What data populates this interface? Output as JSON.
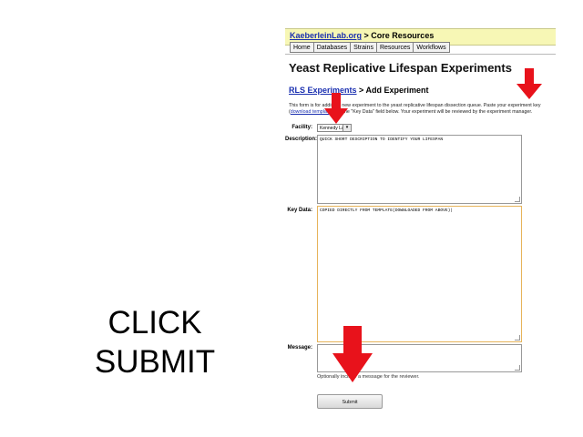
{
  "caption": {
    "line1": "CLICK",
    "line2": "SUBMIT"
  },
  "breadcrumb": {
    "site_link": "KaeberleinLab.org",
    "separator": " > ",
    "section": "Core Resources"
  },
  "nav": {
    "items": [
      "Home",
      "Databases",
      "Strains",
      "Resources",
      "Workflows"
    ]
  },
  "page": {
    "title": "Yeast Replicative Lifespan Experiments",
    "breadcrumb_link": "RLS Experiments",
    "breadcrumb_current": " > Add Experiment"
  },
  "intro": {
    "text_before": "This form is for adding a new experiment to the yeast replicative lifespan dissection queue. Paste your experiment key (",
    "link": "download template",
    "text_after": ") into the \"Key Data\" field below. Your experiment will be reviewed by the experiment manager."
  },
  "form": {
    "facility_label": "Facility:",
    "facility_value": "Kennedy Lab",
    "description_label": "Description:",
    "description_value": "QUICK SHORT DESCRIPTION TO IDENTIFY YOUR LIFESPAN",
    "keydata_label": "Key Data:",
    "keydata_value": "COPIED DIRECTLY FROM TEMPLATE(DOWNLOADED FROM ABOVE)|",
    "message_label": "Message:",
    "message_value": "",
    "message_helper": "Optionally include a message for the reviewer.",
    "submit_label": "Submit"
  },
  "colors": {
    "arrow": "#e8121b",
    "link": "#1a2fb0",
    "header_bg": "#f7f7b5",
    "active_border": "#e7b45a"
  },
  "icons": {
    "arrow": "down-arrow-icon",
    "caret": "chevron-down-icon"
  }
}
